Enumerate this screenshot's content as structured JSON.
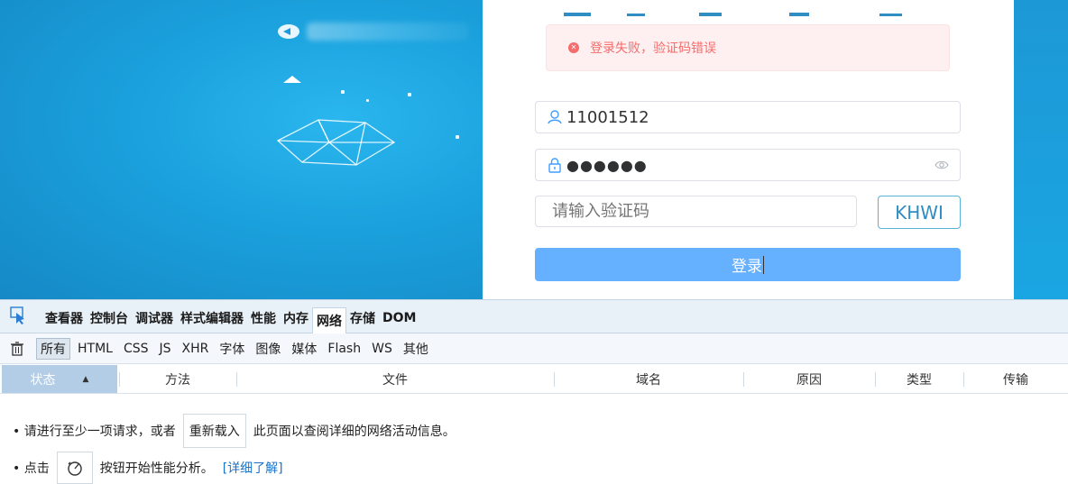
{
  "login": {
    "alert_text": "登录失败，验证码错误",
    "username_value": "11001512",
    "password_mask": "●●●●●●",
    "captcha_placeholder": "请输入验证码",
    "captcha_code": "KHWI",
    "login_label": "登录"
  },
  "devtools": {
    "tabs": [
      "查看器",
      "控制台",
      "调试器",
      "样式编辑器",
      "性能",
      "内存",
      "网络",
      "存储",
      "DOM"
    ],
    "active_tab": "网络",
    "filters": [
      "所有",
      "HTML",
      "CSS",
      "JS",
      "XHR",
      "字体",
      "图像",
      "媒体",
      "Flash",
      "WS",
      "其他"
    ],
    "active_filter": "所有",
    "columns": [
      "状态",
      "方法",
      "文件",
      "域名",
      "原因",
      "类型",
      "传输"
    ],
    "note1_prefix": "• 请进行至少一项请求，或者",
    "reload_label": "重新载入",
    "note1_suffix": "此页面以查阅详细的网络活动信息。",
    "note2_prefix": "• 点击",
    "note2_suffix": "按钮开始性能分析。",
    "learn_more": "[详细了解]"
  },
  "colors": {
    "alert": "#f56c6c",
    "login_button": "#66b1ff",
    "captcha_border": "#58b3d9",
    "link": "#1a73c8"
  }
}
